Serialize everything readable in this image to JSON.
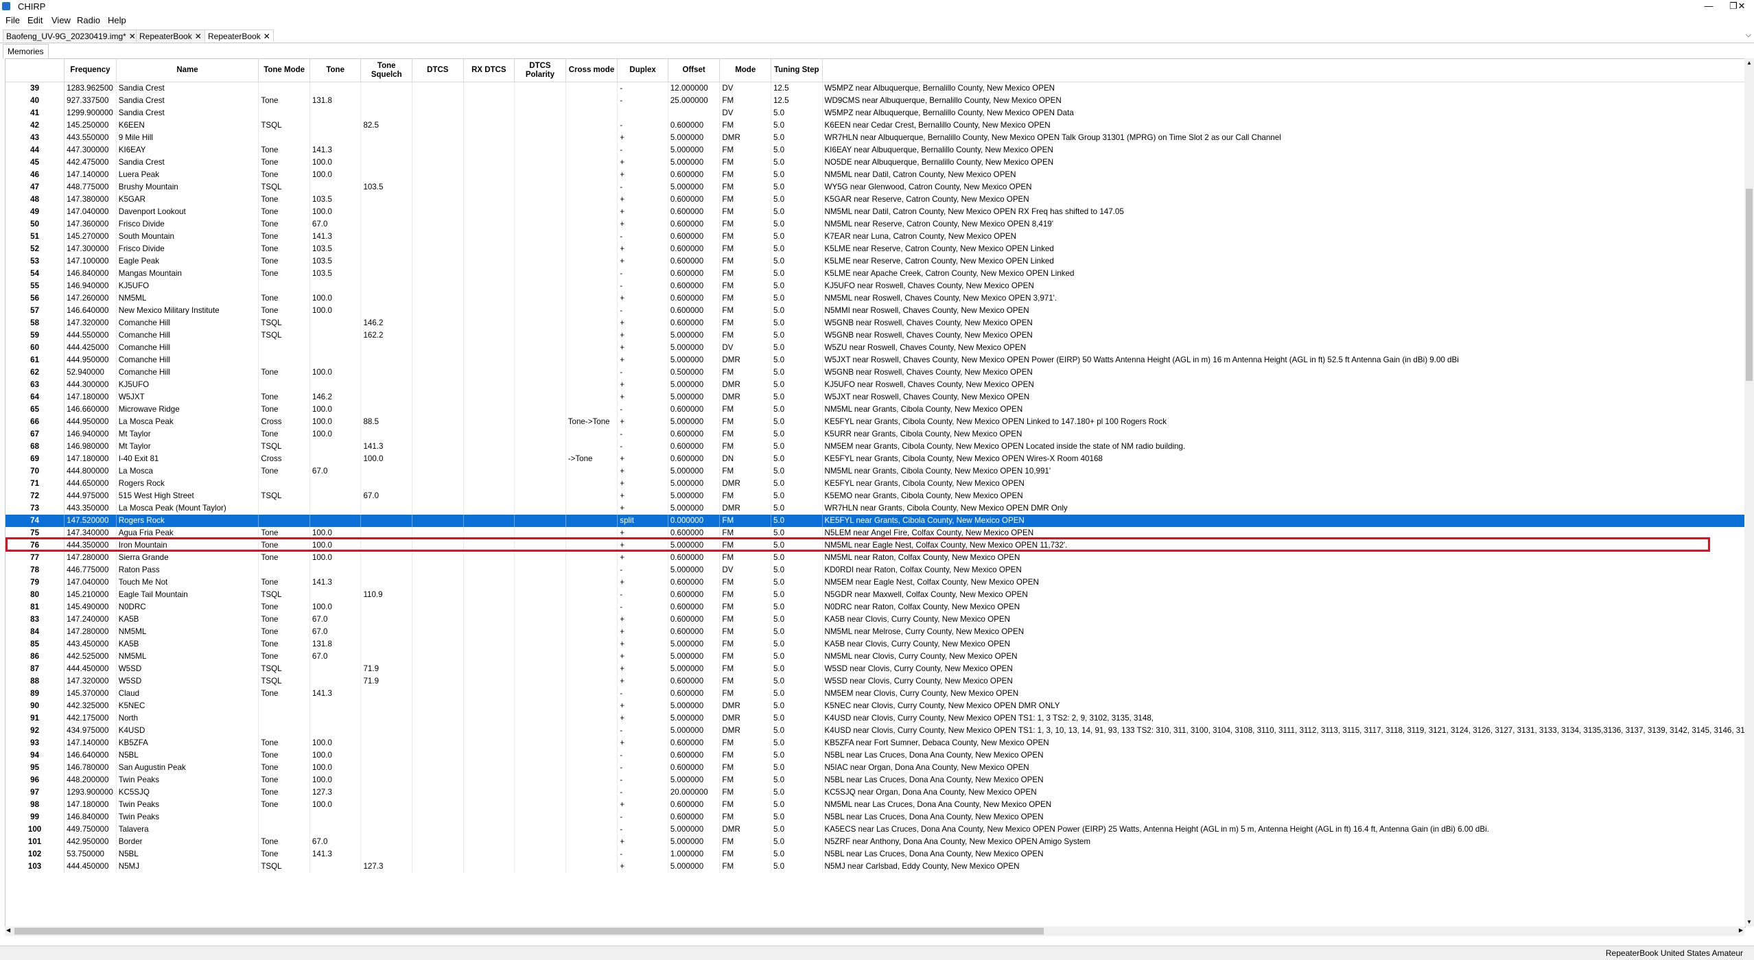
{
  "window": {
    "title": "CHIRP",
    "minimize": "—",
    "restore": "❐",
    "close": "✕"
  },
  "menu": [
    "File",
    "Edit",
    "View",
    "Radio",
    "Help"
  ],
  "tabs": [
    {
      "label": "Baofeng_UV-9G_20230419.img*",
      "close": "✕"
    },
    {
      "label": "RepeaterBook",
      "close": "✕"
    },
    {
      "label": "RepeaterBook",
      "close": "✕"
    }
  ],
  "subtab": "Memories",
  "columns": [
    "",
    "Frequency",
    "Name",
    "Tone Mode",
    "Tone",
    "Tone Squelch",
    "DTCS",
    "RX DTCS",
    "DTCS Polarity",
    "Cross mode",
    "Duplex",
    "Offset",
    "Mode",
    "Tuning Step",
    ""
  ],
  "rows": [
    [
      "39",
      "1283.962500",
      "Sandia Crest",
      "",
      "",
      "",
      "",
      "",
      "",
      "",
      "-",
      "12.000000",
      "DV",
      "12.5",
      "W5MPZ near Albuquerque, Bernalillo County, New Mexico OPEN"
    ],
    [
      "40",
      "927.337500",
      "Sandia Crest",
      "Tone",
      "131.8",
      "",
      "",
      "",
      "",
      "",
      "-",
      "25.000000",
      "FM",
      "12.5",
      "WD9CMS near Albuquerque, Bernalillo County, New Mexico OPEN"
    ],
    [
      "41",
      "1299.900000",
      "Sandia Crest",
      "",
      "",
      "",
      "",
      "",
      "",
      "",
      "",
      "",
      "DV",
      "5.0",
      "W5MPZ near Albuquerque, Bernalillo County, New Mexico OPEN Data"
    ],
    [
      "42",
      "145.250000",
      "K6EEN",
      "TSQL",
      "",
      "82.5",
      "",
      "",
      "",
      "",
      "-",
      "0.600000",
      "FM",
      "5.0",
      "K6EEN near Cedar Crest, Bernalillo County, New Mexico OPEN"
    ],
    [
      "43",
      "443.550000",
      "9 Mile Hill",
      "",
      "",
      "",
      "",
      "",
      "",
      "",
      "+",
      "5.000000",
      "DMR",
      "5.0",
      "WR7HLN near Albuquerque, Bernalillo County, New Mexico OPEN Talk Group 31301 (MPRG) on Time Slot 2 as our Call Channel"
    ],
    [
      "44",
      "447.300000",
      "KI6EAY",
      "Tone",
      "141.3",
      "",
      "",
      "",
      "",
      "",
      "-",
      "5.000000",
      "FM",
      "5.0",
      "KI6EAY near Albuquerque, Bernalillo County, New Mexico OPEN"
    ],
    [
      "45",
      "442.475000",
      "Sandia Crest",
      "Tone",
      "100.0",
      "",
      "",
      "",
      "",
      "",
      "+",
      "5.000000",
      "FM",
      "5.0",
      "NO5DE near Albuquerque, Bernalillo County, New Mexico OPEN"
    ],
    [
      "46",
      "147.140000",
      "Luera Peak",
      "Tone",
      "100.0",
      "",
      "",
      "",
      "",
      "",
      "+",
      "0.600000",
      "FM",
      "5.0",
      "NM5ML near Datil, Catron County, New Mexico OPEN"
    ],
    [
      "47",
      "448.775000",
      "Brushy Mountain",
      "TSQL",
      "",
      "103.5",
      "",
      "",
      "",
      "",
      "-",
      "5.000000",
      "FM",
      "5.0",
      "WY5G near Glenwood, Catron County, New Mexico OPEN"
    ],
    [
      "48",
      "147.380000",
      "K5GAR",
      "Tone",
      "103.5",
      "",
      "",
      "",
      "",
      "",
      "+",
      "0.600000",
      "FM",
      "5.0",
      "K5GAR near Reserve, Catron County, New Mexico OPEN"
    ],
    [
      "49",
      "147.040000",
      "Davenport Lookout",
      "Tone",
      "100.0",
      "",
      "",
      "",
      "",
      "",
      "+",
      "0.600000",
      "FM",
      "5.0",
      "NM5ML near Datil, Catron County, New Mexico OPEN RX Freq has shifted to 147.05"
    ],
    [
      "50",
      "147.360000",
      "Frisco Divide",
      "Tone",
      "67.0",
      "",
      "",
      "",
      "",
      "",
      "+",
      "0.600000",
      "FM",
      "5.0",
      "NM5ML near Reserve, Catron County, New Mexico OPEN 8,419'"
    ],
    [
      "51",
      "145.270000",
      "South Mountain",
      "Tone",
      "141.3",
      "",
      "",
      "",
      "",
      "",
      "-",
      "0.600000",
      "FM",
      "5.0",
      "K7EAR near Luna, Catron County, New Mexico OPEN"
    ],
    [
      "52",
      "147.300000",
      "Frisco Divide",
      "Tone",
      "103.5",
      "",
      "",
      "",
      "",
      "",
      "+",
      "0.600000",
      "FM",
      "5.0",
      "K5LME near Reserve, Catron County, New Mexico OPEN Linked"
    ],
    [
      "53",
      "147.100000",
      "Eagle Peak",
      "Tone",
      "103.5",
      "",
      "",
      "",
      "",
      "",
      "+",
      "0.600000",
      "FM",
      "5.0",
      "K5LME near Reserve, Catron County, New Mexico OPEN Linked"
    ],
    [
      "54",
      "146.840000",
      "Mangas Mountain",
      "Tone",
      "103.5",
      "",
      "",
      "",
      "",
      "",
      "-",
      "0.600000",
      "FM",
      "5.0",
      "K5LME near Apache Creek, Catron County, New Mexico OPEN Linked"
    ],
    [
      "55",
      "146.940000",
      "KJ5UFO",
      "",
      "",
      "",
      "",
      "",
      "",
      "",
      "-",
      "0.600000",
      "FM",
      "5.0",
      "KJ5UFO near Roswell, Chaves County, New Mexico OPEN"
    ],
    [
      "56",
      "147.260000",
      "NM5ML",
      "Tone",
      "100.0",
      "",
      "",
      "",
      "",
      "",
      "+",
      "0.600000",
      "FM",
      "5.0",
      "NM5ML near Roswell, Chaves County, New Mexico OPEN 3,971'."
    ],
    [
      "57",
      "146.640000",
      "New Mexico Military Institute",
      "Tone",
      "100.0",
      "",
      "",
      "",
      "",
      "",
      "-",
      "0.600000",
      "FM",
      "5.0",
      "N5MMI near Roswell, Chaves County, New Mexico OPEN"
    ],
    [
      "58",
      "147.320000",
      "Comanche Hill",
      "TSQL",
      "",
      "146.2",
      "",
      "",
      "",
      "",
      "+",
      "0.600000",
      "FM",
      "5.0",
      "W5GNB near Roswell, Chaves County, New Mexico OPEN"
    ],
    [
      "59",
      "444.550000",
      "Comanche Hill",
      "TSQL",
      "",
      "162.2",
      "",
      "",
      "",
      "",
      "+",
      "5.000000",
      "FM",
      "5.0",
      "W5GNB near Roswell, Chaves County, New Mexico OPEN"
    ],
    [
      "60",
      "444.425000",
      "Comanche Hill",
      "",
      "",
      "",
      "",
      "",
      "",
      "",
      "+",
      "5.000000",
      "DV",
      "5.0",
      "W5ZU near Roswell, Chaves County, New Mexico OPEN"
    ],
    [
      "61",
      "444.950000",
      "Comanche Hill",
      "",
      "",
      "",
      "",
      "",
      "",
      "",
      "+",
      "5.000000",
      "DMR",
      "5.0",
      "W5JXT near Roswell, Chaves County, New Mexico OPEN  Power (EIRP) 50 Watts Antenna Height (AGL in m) 16 m Antenna Height (AGL in ft) 52.5 ft Antenna Gain (in dBi) 9.00 dBi"
    ],
    [
      "62",
      "52.940000",
      "Comanche Hill",
      "Tone",
      "100.0",
      "",
      "",
      "",
      "",
      "",
      "-",
      "0.500000",
      "FM",
      "5.0",
      "W5GNB near Roswell, Chaves County, New Mexico OPEN"
    ],
    [
      "63",
      "444.300000",
      "KJ5UFO",
      "",
      "",
      "",
      "",
      "",
      "",
      "",
      "+",
      "5.000000",
      "DMR",
      "5.0",
      "KJ5UFO near Roswell, Chaves County, New Mexico OPEN"
    ],
    [
      "64",
      "147.180000",
      "W5JXT",
      "Tone",
      "146.2",
      "",
      "",
      "",
      "",
      "",
      "+",
      "5.000000",
      "DMR",
      "5.0",
      "W5JXT near Roswell, Chaves County, New Mexico OPEN"
    ],
    [
      "65",
      "146.660000",
      "Microwave Ridge",
      "Tone",
      "100.0",
      "",
      "",
      "",
      "",
      "",
      "-",
      "0.600000",
      "FM",
      "5.0",
      "NM5ML near Grants, Cibola County, New Mexico OPEN"
    ],
    [
      "66",
      "444.950000",
      "La Mosca Peak",
      "Cross",
      "100.0",
      "88.5",
      "",
      "",
      "",
      "Tone->Tone",
      "+",
      "5.000000",
      "FM",
      "5.0",
      "KE5FYL near Grants, Cibola County, New Mexico OPEN Linked to 147.180+ pl 100 Rogers Rock"
    ],
    [
      "67",
      "146.940000",
      "Mt Taylor",
      "Tone",
      "100.0",
      "",
      "",
      "",
      "",
      "",
      "-",
      "0.600000",
      "FM",
      "5.0",
      "K5URR near Grants, Cibola County, New Mexico OPEN"
    ],
    [
      "68",
      "146.980000",
      "Mt Taylor",
      "TSQL",
      "",
      "141.3",
      "",
      "",
      "",
      "",
      "-",
      "0.600000",
      "FM",
      "5.0",
      "NM5EM near Grants, Cibola County, New Mexico OPEN Located inside the state of NM radio building."
    ],
    [
      "69",
      "147.180000",
      "I-40 Exit 81",
      "Cross",
      "",
      "100.0",
      "",
      "",
      "",
      "->Tone",
      "+",
      "0.600000",
      "DN",
      "5.0",
      "KE5FYL near Grants, Cibola County, New Mexico OPEN Wires-X Room 40168"
    ],
    [
      "70",
      "444.800000",
      "La Mosca",
      "Tone",
      "67.0",
      "",
      "",
      "",
      "",
      "",
      "+",
      "5.000000",
      "FM",
      "5.0",
      "NM5ML near Grants, Cibola County, New Mexico OPEN 10,991'"
    ],
    [
      "71",
      "444.650000",
      "Rogers Rock",
      "",
      "",
      "",
      "",
      "",
      "",
      "",
      "+",
      "5.000000",
      "DMR",
      "5.0",
      "KE5FYL near Grants, Cibola County, New Mexico OPEN"
    ],
    [
      "72",
      "444.975000",
      "515 West High Street",
      "TSQL",
      "",
      "67.0",
      "",
      "",
      "",
      "",
      "+",
      "5.000000",
      "FM",
      "5.0",
      "K5EMO near Grants, Cibola County, New Mexico OPEN"
    ],
    [
      "73",
      "443.350000",
      "La Mosca Peak (Mount Taylor)",
      "",
      "",
      "",
      "",
      "",
      "",
      "",
      "+",
      "5.000000",
      "DMR",
      "5.0",
      "WR7HLN near Grants, Cibola County, New Mexico OPEN DMR Only"
    ],
    [
      "74",
      "147.520000",
      "Rogers Rock",
      "",
      "",
      "",
      "",
      "",
      "",
      "",
      "split",
      "0.000000",
      "FM",
      "5.0",
      "KE5FYL near Grants, Cibola County, New Mexico OPEN"
    ],
    [
      "75",
      "147.340000",
      "Agua Fria Peak",
      "Tone",
      "100.0",
      "",
      "",
      "",
      "",
      "",
      "+",
      "0.600000",
      "FM",
      "5.0",
      "N5LEM near Angel Fire, Colfax County, New Mexico OPEN"
    ],
    [
      "76",
      "444.350000",
      "Iron Mountain",
      "Tone",
      "100.0",
      "",
      "",
      "",
      "",
      "",
      "+",
      "5.000000",
      "FM",
      "5.0",
      "NM5ML near Eagle Nest, Colfax County, New Mexico OPEN 11,732'."
    ],
    [
      "77",
      "147.280000",
      "Sierra Grande",
      "Tone",
      "100.0",
      "",
      "",
      "",
      "",
      "",
      "+",
      "0.600000",
      "FM",
      "5.0",
      "NM5ML near Raton, Colfax County, New Mexico OPEN"
    ],
    [
      "78",
      "446.775000",
      "Raton Pass",
      "",
      "",
      "",
      "",
      "",
      "",
      "",
      "-",
      "5.000000",
      "DV",
      "5.0",
      "KD0RDI near Raton, Colfax County, New Mexico OPEN"
    ],
    [
      "79",
      "147.040000",
      "Touch Me Not",
      "Tone",
      "141.3",
      "",
      "",
      "",
      "",
      "",
      "+",
      "0.600000",
      "FM",
      "5.0",
      "NM5EM near Eagle Nest, Colfax County, New Mexico OPEN"
    ],
    [
      "80",
      "145.210000",
      "Eagle Tail Mountain",
      "TSQL",
      "",
      "110.9",
      "",
      "",
      "",
      "",
      "-",
      "0.600000",
      "FM",
      "5.0",
      "N5GDR near Maxwell, Colfax County, New Mexico OPEN"
    ],
    [
      "81",
      "145.490000",
      "N0DRC",
      "Tone",
      "100.0",
      "",
      "",
      "",
      "",
      "",
      "-",
      "0.600000",
      "FM",
      "5.0",
      "N0DRC near Raton, Colfax County, New Mexico OPEN"
    ],
    [
      "83",
      "147.240000",
      "KA5B",
      "Tone",
      "67.0",
      "",
      "",
      "",
      "",
      "",
      "+",
      "0.600000",
      "FM",
      "5.0",
      "KA5B near Clovis, Curry County, New Mexico OPEN"
    ],
    [
      "84",
      "147.280000",
      "NM5ML",
      "Tone",
      "67.0",
      "",
      "",
      "",
      "",
      "",
      "+",
      "0.600000",
      "FM",
      "5.0",
      "NM5ML near Melrose, Curry County, New Mexico OPEN"
    ],
    [
      "85",
      "443.450000",
      "KA5B",
      "Tone",
      "131.8",
      "",
      "",
      "",
      "",
      "",
      "+",
      "5.000000",
      "FM",
      "5.0",
      "KA5B near Clovis, Curry County, New Mexico OPEN"
    ],
    [
      "86",
      "442.525000",
      "NM5ML",
      "Tone",
      "67.0",
      "",
      "",
      "",
      "",
      "",
      "+",
      "5.000000",
      "FM",
      "5.0",
      "NM5ML near Clovis, Curry County, New Mexico OPEN"
    ],
    [
      "87",
      "444.450000",
      "W5SD",
      "TSQL",
      "",
      "71.9",
      "",
      "",
      "",
      "",
      "+",
      "5.000000",
      "FM",
      "5.0",
      "W5SD near Clovis, Curry County, New Mexico OPEN"
    ],
    [
      "88",
      "147.320000",
      "W5SD",
      "TSQL",
      "",
      "71.9",
      "",
      "",
      "",
      "",
      "+",
      "0.600000",
      "FM",
      "5.0",
      "W5SD near Clovis, Curry County, New Mexico OPEN"
    ],
    [
      "89",
      "145.370000",
      "Claud",
      "Tone",
      "141.3",
      "",
      "",
      "",
      "",
      "",
      "-",
      "0.600000",
      "FM",
      "5.0",
      "NM5EM near Clovis, Curry County, New Mexico OPEN"
    ],
    [
      "90",
      "442.325000",
      "K5NEC",
      "",
      "",
      "",
      "",
      "",
      "",
      "",
      "+",
      "5.000000",
      "DMR",
      "5.0",
      "K5NEC near Clovis, Curry County, New Mexico OPEN DMR ONLY"
    ],
    [
      "91",
      "442.175000",
      "North",
      "",
      "",
      "",
      "",
      "",
      "",
      "",
      "+",
      "5.000000",
      "DMR",
      "5.0",
      "K4USD near Clovis, Curry County, New Mexico OPEN TS1: 1, 3 TS2: 2, 9, 3102, 3135, 3148,"
    ],
    [
      "92",
      "434.975000",
      "K4USD",
      "",
      "",
      "",
      "",
      "",
      "",
      "",
      "-",
      "5.000000",
      "DMR",
      "5.0",
      "K4USD near Clovis, Curry County, New Mexico OPEN TS1: 1, 3, 10, 13, 14, 91, 93, 133 TS2: 310, 311, 3100, 3104, 3108, 3110, 3111, 3112, 3113, 3115, 3117, 3118, 3119, 3121, 3124, 3126, 3127, 3131, 3133, 3134, 3135,3136, 3137, 3139, 3142, 3145, 3146, 3147, 3188, 31("
    ],
    [
      "93",
      "147.140000",
      "KB5ZFA",
      "Tone",
      "100.0",
      "",
      "",
      "",
      "",
      "",
      "+",
      "0.600000",
      "FM",
      "5.0",
      "KB5ZFA near Fort Sumner, Debaca County, New Mexico OPEN"
    ],
    [
      "94",
      "146.640000",
      "N5BL",
      "Tone",
      "100.0",
      "",
      "",
      "",
      "",
      "",
      "-",
      "0.600000",
      "FM",
      "5.0",
      "N5BL near Las Cruces, Dona Ana County, New Mexico OPEN"
    ],
    [
      "95",
      "146.780000",
      "San Augustin Peak",
      "Tone",
      "100.0",
      "",
      "",
      "",
      "",
      "",
      "-",
      "0.600000",
      "FM",
      "5.0",
      "N5IAC near Organ, Dona Ana County, New Mexico OPEN"
    ],
    [
      "96",
      "448.200000",
      "Twin Peaks",
      "Tone",
      "100.0",
      "",
      "",
      "",
      "",
      "",
      "-",
      "5.000000",
      "FM",
      "5.0",
      "N5BL near Las Cruces, Dona Ana County, New Mexico OPEN"
    ],
    [
      "97",
      "1293.900000",
      "KC5SJQ",
      "Tone",
      "127.3",
      "",
      "",
      "",
      "",
      "",
      "-",
      "20.000000",
      "FM",
      "5.0",
      "KC5SJQ near Organ, Dona Ana County, New Mexico OPEN"
    ],
    [
      "98",
      "147.180000",
      "Twin Peaks",
      "Tone",
      "100.0",
      "",
      "",
      "",
      "",
      "",
      "+",
      "0.600000",
      "FM",
      "5.0",
      "NM5ML near Las Cruces, Dona Ana County, New Mexico OPEN"
    ],
    [
      "99",
      "146.840000",
      "Twin Peaks",
      "",
      "",
      "",
      "",
      "",
      "",
      "",
      "-",
      "0.600000",
      "FM",
      "5.0",
      "N5BL near Las Cruces, Dona Ana County, New Mexico OPEN"
    ],
    [
      "100",
      "449.750000",
      "Talavera",
      "",
      "",
      "",
      "",
      "",
      "",
      "",
      "-",
      "5.000000",
      "DMR",
      "5.0",
      "KA5ECS near Las Cruces, Dona Ana County, New Mexico OPEN Power (EIRP) 25 Watts, Antenna Height (AGL in m) 5 m, Antenna Height (AGL in ft) 16.4 ft, Antenna Gain (in dBi) 6.00 dBi."
    ],
    [
      "101",
      "442.950000",
      "Border",
      "Tone",
      "67.0",
      "",
      "",
      "",
      "",
      "",
      "+",
      "5.000000",
      "FM",
      "5.0",
      "N5ZRF near Anthony, Dona Ana County, New Mexico OPEN Amigo System"
    ],
    [
      "102",
      "53.750000",
      "N5BL",
      "Tone",
      "141.3",
      "",
      "",
      "",
      "",
      "",
      "-",
      "1.000000",
      "FM",
      "5.0",
      "N5BL near Las Cruces, Dona Ana County, New Mexico OPEN"
    ],
    [
      "103",
      "444.450000",
      "N5MJ",
      "TSQL",
      "",
      "127.3",
      "",
      "",
      "",
      "",
      "+",
      "5.000000",
      "FM",
      "5.0",
      "N5MJ near Carlsbad, Eddy County, New Mexico OPEN"
    ]
  ],
  "selected_row": "74",
  "status": "RepeaterBook United States Amateur",
  "colors": {
    "selection": "#0a6fd6",
    "highlight_box": "#e01020"
  }
}
